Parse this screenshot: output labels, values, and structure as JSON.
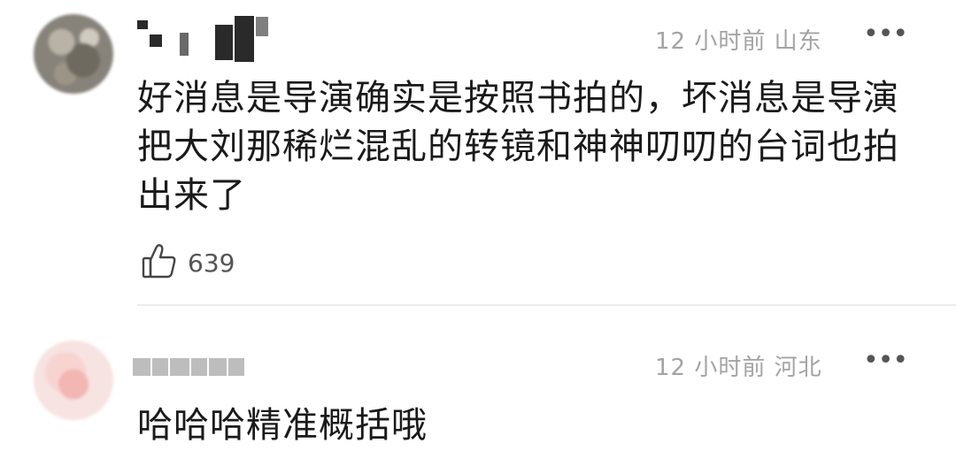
{
  "comments": [
    {
      "meta": "12 小时前 山东",
      "more": "•••",
      "text": "好消息是导演确实是按照书拍的，坏消息是导演把大刘那稀烂混乱的转镜和神神叨叨的台词也拍出来了",
      "likes": "639",
      "like_icon": "thumbs-up-icon",
      "username_pixelated": true
    },
    {
      "meta": "12 小时前 河北",
      "more": "•••",
      "text": "哈哈哈精准概括哦",
      "username_pixelated": true
    }
  ],
  "colors": {
    "meta": "#a3a3a3",
    "text": "#1a1a1a",
    "divider": "#ececec"
  }
}
